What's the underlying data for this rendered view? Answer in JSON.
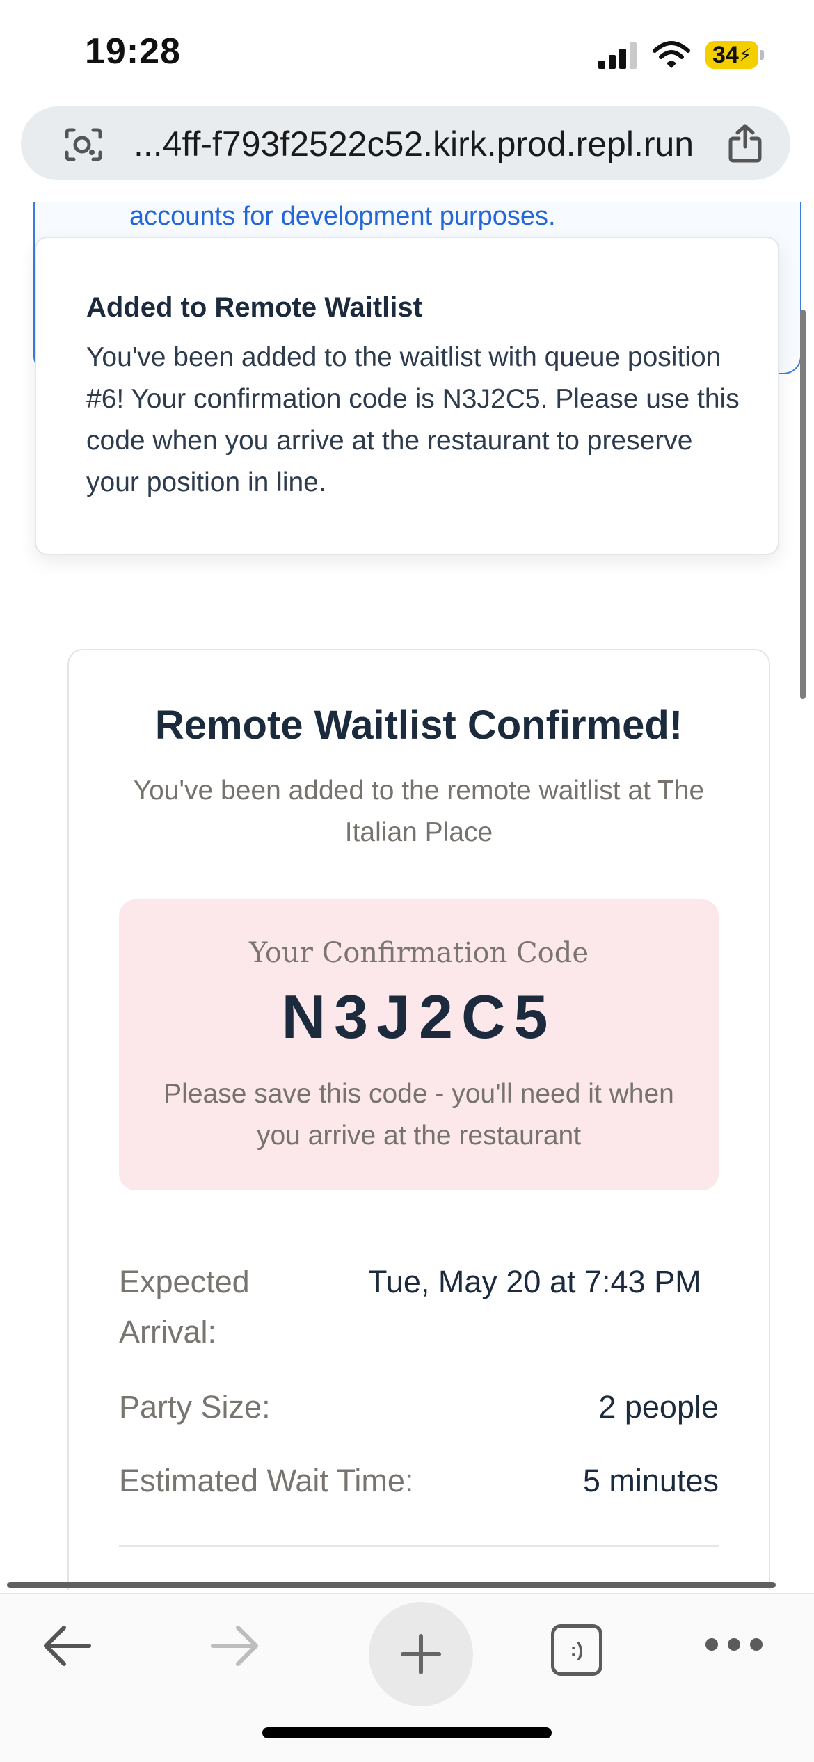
{
  "status_bar": {
    "time": "19:28",
    "battery": "34"
  },
  "browser": {
    "url": "...4ff-f793f2522c52.kirk.prod.repl.run"
  },
  "dev_notice": {
    "text": "accounts for development purposes."
  },
  "toast": {
    "title": "Added to Remote Waitlist",
    "body": "You've been added to the waitlist with queue position #6! Your confirmation code is N3J2C5. Please use this code when you arrive at the restaurant to preserve your position in line."
  },
  "confirmation": {
    "title": "Remote Waitlist Confirmed!",
    "subtitle": "You've been added to the remote waitlist at The Italian Place",
    "code_label": "Your Confirmation Code",
    "code": "N3J2C5",
    "code_note": "Please save this code - you'll need it when you arrive at the restaurant",
    "details": {
      "expected_arrival_label": "Expected Arrival:",
      "expected_arrival_value": "Tue, May 20 at 7:43 PM",
      "party_size_label": "Party Size:",
      "party_size_value": "2 people",
      "wait_time_label": "Estimated Wait Time:",
      "wait_time_value": "5 minutes"
    }
  },
  "toolbar": {
    "tabs_label": ":)"
  },
  "icons": [
    "signal-icon",
    "wifi-icon",
    "battery-icon",
    "lens-icon",
    "share-icon",
    "back-arrow-icon",
    "forward-arrow-icon",
    "plus-icon",
    "tabs-icon",
    "more-icon"
  ]
}
